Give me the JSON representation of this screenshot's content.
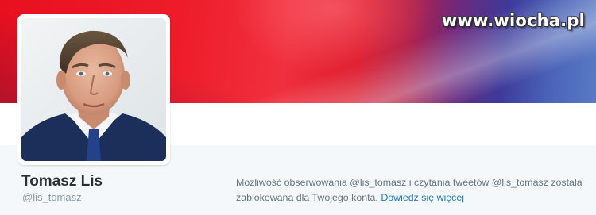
{
  "watermark": "www.wiocha.pl",
  "profile": {
    "name": "Tomasz Lis",
    "handle": "@lis_tomasz"
  },
  "notice": {
    "text": "Możliwość obserwowania @lis_tomasz i czytania tweetów @lis_tomasz została zablokowana dla Twojego konta.",
    "link_label": "Dowiedz się więcej"
  },
  "colors": {
    "banner_red": "#ee1c2a",
    "banner_blue": "#4a63b8",
    "link": "#1a7abf",
    "name": "#292f33",
    "muted": "#8899a6"
  }
}
